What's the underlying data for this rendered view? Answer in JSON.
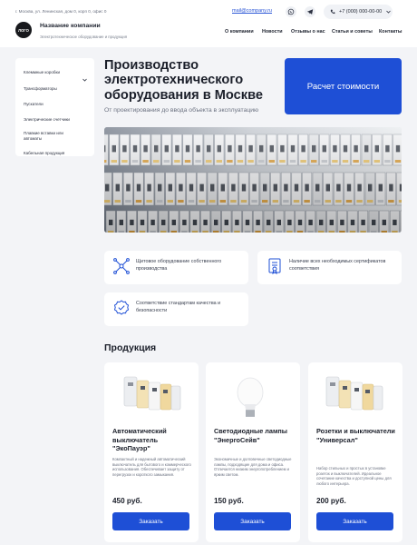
{
  "topbar": {
    "address": "г. Москва, ул. Ленинская, дом 0, корп 0, офис 0",
    "email": "mail@company.ru",
    "whatsapp_icon": "whatsapp-icon",
    "telegram_icon": "telegram-icon",
    "phone": "+7 (000) 000-00-00"
  },
  "header": {
    "logo": "ЛОГО",
    "company_name": "Название компании",
    "company_sub": "Электротехническое оборудование и продукция",
    "nav": [
      "О компании",
      "Новости",
      "Отзывы о нас",
      "Статьи и советы",
      "Контакты"
    ]
  },
  "sidebar": {
    "items": [
      "Клеммные коробки",
      "Трансформаторы",
      "Пускатели",
      "Электрические счетчики",
      "Плавкие вставки или автоматы",
      "Кабельная продукция"
    ]
  },
  "hero": {
    "title": "Производство электротехнического оборудования в Москве",
    "subtitle": "От проектирования до ввода объекта в эксплуатацию",
    "cta": "Расчет стоимости"
  },
  "features": [
    {
      "icon": "network-icon",
      "text": "Щитовое оборудование собственного производства"
    },
    {
      "icon": "certificate-icon",
      "text": "Наличие всех необходимых сертификатов соответствия"
    },
    {
      "icon": "quality-seal-icon",
      "text": "Соответствие стандартам качества и безопасности"
    }
  ],
  "products": {
    "title": "Продукция",
    "items": [
      {
        "name": "Автоматический выключатель \"ЭкоПауэр\"",
        "desc": "Компактный и надежный автоматический выключатель для бытового и коммерческого использования. Обеспечивает защиту от перегрузок и короткого замыкания.",
        "price": "450 руб.",
        "button": "Заказать"
      },
      {
        "name": "Светодиодные лампы \"ЭнергоСейв\"",
        "desc": "Экономичные и долговечные светодиодные лампы, подходящие для дома и офиса. Отличается низким энергопотреблением и ярким светом.",
        "price": "150 руб.",
        "button": "Заказать"
      },
      {
        "name": "Розетки и выключатели \"Универсал\"",
        "desc": "Набор стильных и простых в установке розеток и выключателей. Идеальное сочетание качества и доступной цены для любого интерьера.",
        "price": "200 руб.",
        "button": "Заказать"
      }
    ]
  },
  "colors": {
    "accent": "#1e4fd6",
    "background": "#f3f4f7",
    "card": "#ffffff",
    "text": "#1b1f2a"
  }
}
